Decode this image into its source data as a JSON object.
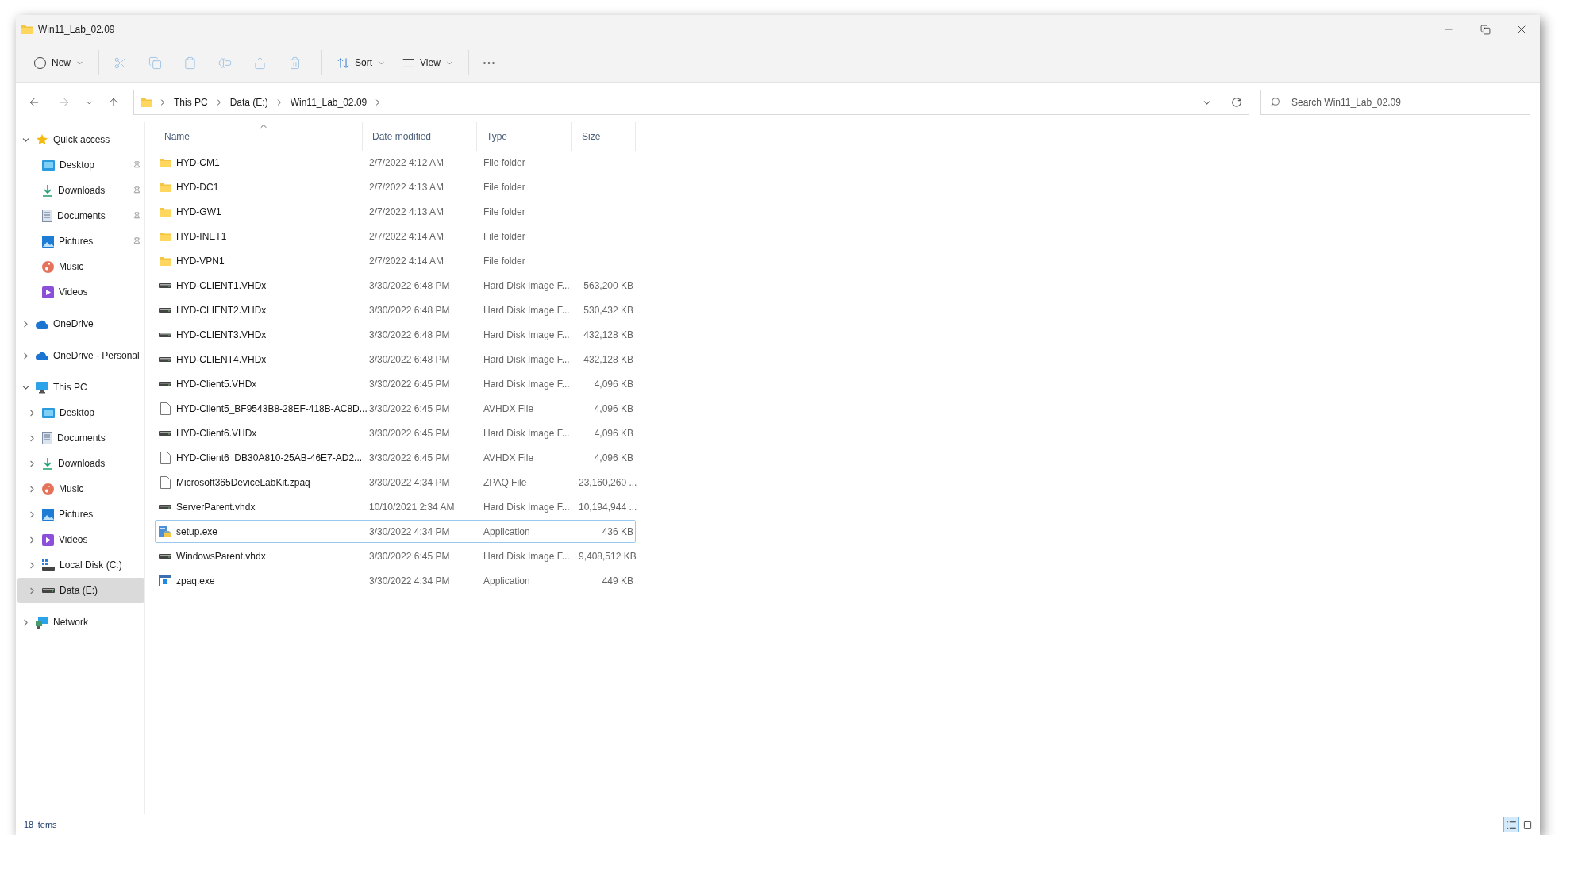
{
  "window": {
    "title": "Win11_Lab_02.09"
  },
  "toolbar": [
    {
      "kind": "new",
      "label": "New",
      "disabled": false
    },
    {
      "kind": "cut",
      "disabled": true
    },
    {
      "kind": "copy",
      "disabled": true
    },
    {
      "kind": "paste",
      "disabled": true
    },
    {
      "kind": "rename",
      "disabled": true
    },
    {
      "kind": "share",
      "disabled": true
    },
    {
      "kind": "delete",
      "disabled": true
    },
    {
      "kind": "sort",
      "label": "Sort",
      "disabled": false
    },
    {
      "kind": "view",
      "label": "View",
      "disabled": false
    },
    {
      "kind": "more",
      "disabled": false
    }
  ],
  "address": {
    "path": [
      "This PC",
      "Data (E:)",
      "Win11_Lab_02.09"
    ]
  },
  "search": {
    "placeholder": "Search Win11_Lab_02.09"
  },
  "sidebar": {
    "items": [
      {
        "label": "Quick access",
        "kind": "star",
        "expandable": true,
        "expanded": true,
        "pinned": false,
        "selected": false,
        "children": [
          {
            "label": "Desktop",
            "kind": "desktop",
            "expandable": false,
            "expanded": false,
            "pinned": true,
            "selected": false
          },
          {
            "label": "Downloads",
            "kind": "downloads",
            "expandable": false,
            "expanded": false,
            "pinned": true,
            "selected": false
          },
          {
            "label": "Documents",
            "kind": "documents",
            "expandable": false,
            "expanded": false,
            "pinned": true,
            "selected": false
          },
          {
            "label": "Pictures",
            "kind": "pictures",
            "expandable": false,
            "expanded": false,
            "pinned": true,
            "selected": false
          },
          {
            "label": "Music",
            "kind": "music",
            "expandable": false,
            "expanded": false,
            "pinned": false,
            "selected": false
          },
          {
            "label": "Videos",
            "kind": "videos",
            "expandable": false,
            "expanded": false,
            "pinned": false,
            "selected": false
          }
        ]
      },
      {
        "label": "OneDrive",
        "kind": "cloud",
        "expandable": true,
        "expanded": false,
        "pinned": false,
        "selected": false
      },
      {
        "label": "OneDrive - Personal",
        "kind": "cloud",
        "expandable": true,
        "expanded": false,
        "pinned": false,
        "selected": false
      },
      {
        "label": "This PC",
        "kind": "pc",
        "expandable": true,
        "expanded": true,
        "pinned": false,
        "selected": false,
        "children": [
          {
            "label": "Desktop",
            "kind": "desktop",
            "expandable": true,
            "expanded": false,
            "pinned": false,
            "selected": false
          },
          {
            "label": "Documents",
            "kind": "documents",
            "expandable": true,
            "expanded": false,
            "pinned": false,
            "selected": false
          },
          {
            "label": "Downloads",
            "kind": "downloads",
            "expandable": true,
            "expanded": false,
            "pinned": false,
            "selected": false
          },
          {
            "label": "Music",
            "kind": "music",
            "expandable": true,
            "expanded": false,
            "pinned": false,
            "selected": false
          },
          {
            "label": "Pictures",
            "kind": "pictures",
            "expandable": true,
            "expanded": false,
            "pinned": false,
            "selected": false
          },
          {
            "label": "Videos",
            "kind": "videos",
            "expandable": true,
            "expanded": false,
            "pinned": false,
            "selected": false
          },
          {
            "label": "Local Disk (C:)",
            "kind": "system",
            "expandable": true,
            "expanded": false,
            "pinned": false,
            "selected": false
          },
          {
            "label": "Data (E:)",
            "kind": "drive",
            "expandable": true,
            "expanded": false,
            "pinned": false,
            "selected": true
          }
        ]
      },
      {
        "label": "Network",
        "kind": "network",
        "expandable": true,
        "expanded": false,
        "pinned": false,
        "selected": false
      }
    ]
  },
  "table": {
    "columns": [
      {
        "label": "Name",
        "sorted": true
      },
      {
        "label": "Date modified",
        "sorted": false
      },
      {
        "label": "Type",
        "sorted": false
      },
      {
        "label": "Size",
        "sorted": false
      }
    ],
    "rows": [
      {
        "kind": "folder",
        "name": "HYD-CM1",
        "date": "2/7/2022 4:12 AM",
        "type": "File folder",
        "size": "",
        "selected": false
      },
      {
        "kind": "folder",
        "name": "HYD-DC1",
        "date": "2/7/2022 4:13 AM",
        "type": "File folder",
        "size": "",
        "selected": false
      },
      {
        "kind": "folder",
        "name": "HYD-GW1",
        "date": "2/7/2022 4:13 AM",
        "type": "File folder",
        "size": "",
        "selected": false
      },
      {
        "kind": "folder",
        "name": "HYD-INET1",
        "date": "2/7/2022 4:14 AM",
        "type": "File folder",
        "size": "",
        "selected": false
      },
      {
        "kind": "folder",
        "name": "HYD-VPN1",
        "date": "2/7/2022 4:14 AM",
        "type": "File folder",
        "size": "",
        "selected": false
      },
      {
        "kind": "disk",
        "name": "HYD-CLIENT1.VHDx",
        "date": "3/30/2022 6:48 PM",
        "type": "Hard Disk Image F...",
        "size": "563,200 KB",
        "selected": false
      },
      {
        "kind": "disk",
        "name": "HYD-CLIENT2.VHDx",
        "date": "3/30/2022 6:48 PM",
        "type": "Hard Disk Image F...",
        "size": "530,432 KB",
        "selected": false
      },
      {
        "kind": "disk",
        "name": "HYD-CLIENT3.VHDx",
        "date": "3/30/2022 6:48 PM",
        "type": "Hard Disk Image F...",
        "size": "432,128 KB",
        "selected": false
      },
      {
        "kind": "disk",
        "name": "HYD-CLIENT4.VHDx",
        "date": "3/30/2022 6:48 PM",
        "type": "Hard Disk Image F...",
        "size": "432,128 KB",
        "selected": false
      },
      {
        "kind": "disk",
        "name": "HYD-Client5.VHDx",
        "date": "3/30/2022 6:45 PM",
        "type": "Hard Disk Image F...",
        "size": "4,096 KB",
        "selected": false
      },
      {
        "kind": "file",
        "name": "HYD-Client5_BF9543B8-28EF-418B-AC8D...",
        "date": "3/30/2022 6:45 PM",
        "type": "AVHDX File",
        "size": "4,096 KB",
        "selected": false
      },
      {
        "kind": "disk",
        "name": "HYD-Client6.VHDx",
        "date": "3/30/2022 6:45 PM",
        "type": "Hard Disk Image F...",
        "size": "4,096 KB",
        "selected": false
      },
      {
        "kind": "file",
        "name": "HYD-Client6_DB30A810-25AB-46E7-AD2...",
        "date": "3/30/2022 6:45 PM",
        "type": "AVHDX File",
        "size": "4,096 KB",
        "selected": false
      },
      {
        "kind": "file",
        "name": "Microsoft365DeviceLabKit.zpaq",
        "date": "3/30/2022 4:34 PM",
        "type": "ZPAQ File",
        "size": "23,160,260 ...",
        "selected": false
      },
      {
        "kind": "disk",
        "name": "ServerParent.vhdx",
        "date": "10/10/2021 2:34 AM",
        "type": "Hard Disk Image F...",
        "size": "10,194,944 ...",
        "selected": false
      },
      {
        "kind": "setup",
        "name": "setup.exe",
        "date": "3/30/2022 4:34 PM",
        "type": "Application",
        "size": "436 KB",
        "selected": true
      },
      {
        "kind": "disk",
        "name": "WindowsParent.vhdx",
        "date": "3/30/2022 6:45 PM",
        "type": "Hard Disk Image F...",
        "size": "9,408,512 KB",
        "selected": false
      },
      {
        "kind": "app",
        "name": "zpaq.exe",
        "date": "3/30/2022 4:34 PM",
        "type": "Application",
        "size": "449 KB",
        "selected": false
      }
    ]
  },
  "status_bar": {
    "text": "18 items",
    "views": [
      {
        "kind": "details",
        "selected": true
      },
      {
        "kind": "tiles",
        "selected": false
      }
    ]
  }
}
